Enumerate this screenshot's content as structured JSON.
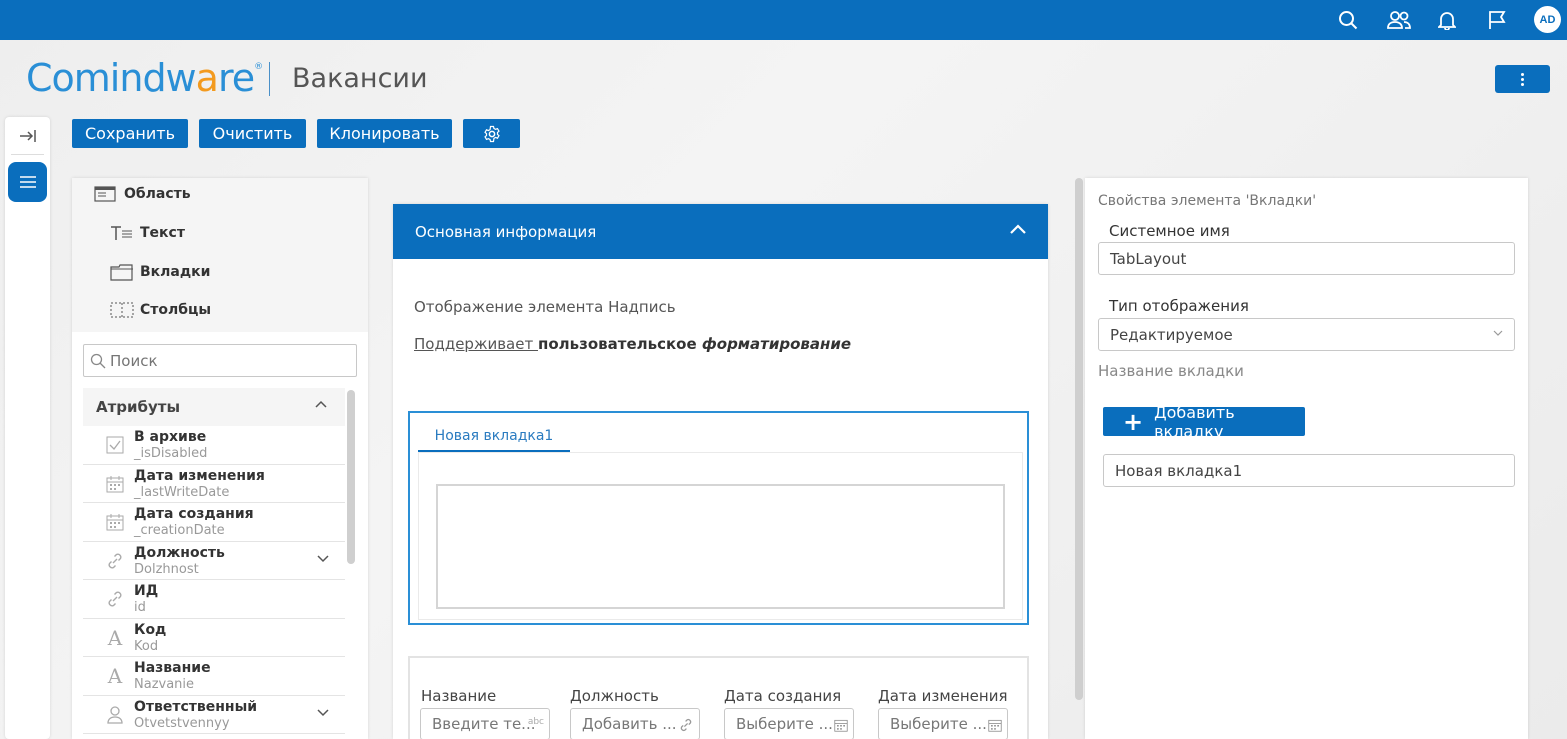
{
  "app": {
    "brand_prefix": "Comindw",
    "brand_accent": "a",
    "brand_suffix": "re",
    "brand_reg": "®",
    "page_title": "Вакансии",
    "user_initials": "AD",
    "accent_color": "#0a6ebd"
  },
  "topbar": {
    "icons": [
      "search-icon",
      "users-icon",
      "bell-icon",
      "flag-icon"
    ]
  },
  "toolbar": {
    "save_label": "Сохранить",
    "clear_label": "Очистить",
    "clone_label": "Клонировать",
    "settings_icon": "gear-icon"
  },
  "palette": {
    "items": [
      {
        "label": "Область",
        "icon": "area-icon"
      },
      {
        "label": "Текст",
        "icon": "text-icon"
      },
      {
        "label": "Вкладки",
        "icon": "tabs-icon"
      },
      {
        "label": "Столбцы",
        "icon": "columns-icon"
      }
    ],
    "search_placeholder": "Поиск",
    "attributes_title": "Атрибуты",
    "attributes": [
      {
        "name": "В архиве",
        "system": "_isDisabled",
        "icon": "checkbox-icon",
        "expandable": false
      },
      {
        "name": "Дата изменения",
        "system": "_lastWriteDate",
        "icon": "calendar-icon",
        "expandable": false
      },
      {
        "name": "Дата создания",
        "system": "_creationDate",
        "icon": "calendar-icon",
        "expandable": false
      },
      {
        "name": "Должность",
        "system": "Dolzhnost",
        "icon": "link-icon",
        "expandable": true
      },
      {
        "name": "ИД",
        "system": "id",
        "icon": "link-icon",
        "expandable": false
      },
      {
        "name": "Код",
        "system": "Kod",
        "icon": "text-a-icon",
        "expandable": false
      },
      {
        "name": "Название",
        "system": "Nazvanie",
        "icon": "text-a-icon",
        "expandable": false
      },
      {
        "name": "Ответственный",
        "system": "Otvetstvennyy",
        "icon": "person-icon",
        "expandable": true
      }
    ]
  },
  "form": {
    "section_title": "Основная информация",
    "caption_text": "Отображение элемента Надпись",
    "rich_underlined": "Поддерживает ",
    "rich_bold": "пользовательское ",
    "rich_bold_italic": "форматирование",
    "tab_label": "Новая вкладка1",
    "fields": [
      {
        "label": "Название",
        "placeholder": "Введите те...",
        "suffix": "abc"
      },
      {
        "label": "Должность",
        "placeholder": "Добавить ...",
        "suffix": "link"
      },
      {
        "label": "Дата создания",
        "placeholder": "Выберите ...",
        "suffix": "calendar"
      },
      {
        "label": "Дата изменения",
        "placeholder": "Выберите ...",
        "suffix": "calendar"
      }
    ]
  },
  "properties": {
    "title": "Свойства элемента 'Вкладки'",
    "system_name_label": "Системное имя",
    "system_name_value": "TabLayout",
    "display_type_label": "Тип отображения",
    "display_type_value": "Редактируемое",
    "tab_name_label": "Название вкладки",
    "add_tab_label": "Добавить вкладку",
    "tab_name_value": "Новая вкладка1"
  }
}
